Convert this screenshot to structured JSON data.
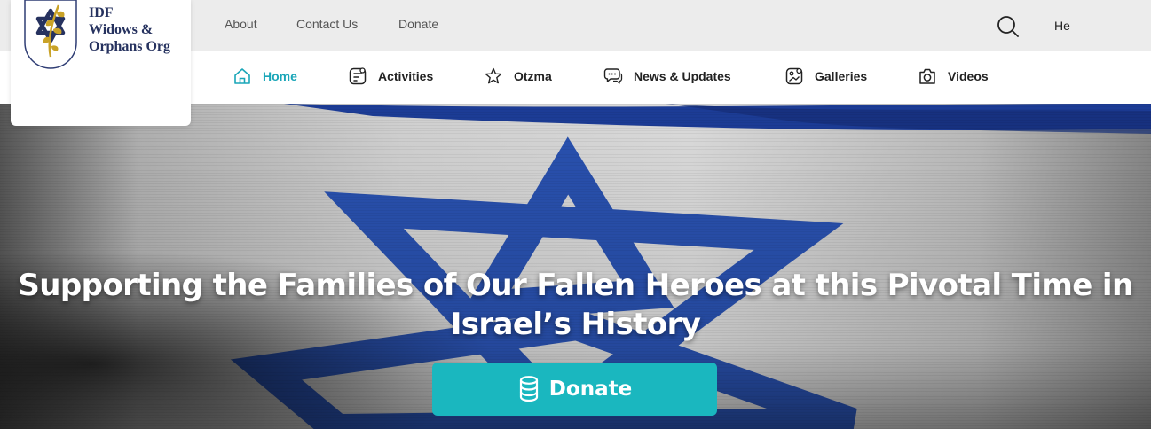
{
  "brand": {
    "name_lines": [
      "IDF",
      "Widows &",
      "Orphans Org"
    ],
    "logo_icon": "star-of-david-olive-branch-emblem",
    "colors": {
      "navy": "#26325f",
      "gold": "#c9a227",
      "teal": "#1ab7bf",
      "blue": "#2b55b8"
    }
  },
  "top_links": {
    "about": "About",
    "contact": "Contact Us",
    "donate": "Donate"
  },
  "search_icon": "search-icon",
  "language_label": "He",
  "nav": {
    "active": "Home",
    "items": [
      {
        "label": "Home",
        "icon": "home-icon"
      },
      {
        "label": "Activities",
        "icon": "activities-icon"
      },
      {
        "label": "Otzma",
        "icon": "star-icon"
      },
      {
        "label": "News & Updates",
        "icon": "chat-bubbles-icon"
      },
      {
        "label": "Galleries",
        "icon": "gallery-icon"
      },
      {
        "label": "Videos",
        "icon": "camera-icon"
      }
    ]
  },
  "hero": {
    "background": "israeli-flag-close-up",
    "title_lines": [
      "Supporting the Families of Our Fallen Heroes at this Pivotal Time in",
      "Israel’s History"
    ],
    "cta_label": "Donate",
    "cta_icon": "coins-stack-icon"
  }
}
